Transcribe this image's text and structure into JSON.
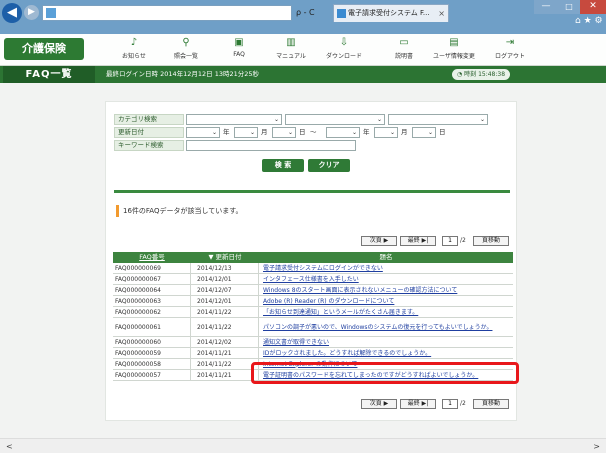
{
  "browser": {
    "address_controls": "ρ - C",
    "tab_title": "電子請求受付システム F...",
    "tab_close": "×",
    "window_controls": [
      "—",
      "□",
      "✕"
    ],
    "tools_icons": "⌂ ★ ⚙"
  },
  "header": {
    "brand": "介護保険",
    "menu": [
      {
        "label": "お知らせ",
        "icon": "bell-icon"
      },
      {
        "label": "照会一覧",
        "icon": "search-icon"
      },
      {
        "label": "FAQ",
        "icon": "faq-icon"
      },
      {
        "label": "マニュアル",
        "icon": "book-icon"
      },
      {
        "label": "ダウンロード",
        "icon": "download-icon"
      },
      {
        "label": "説明書",
        "icon": "monitor-icon"
      },
      {
        "label": "ユーザ情報変更",
        "icon": "user-icon"
      },
      {
        "label": "ログアウト",
        "icon": "logout-icon"
      }
    ]
  },
  "strip": {
    "page_tab": "FAQ一覧",
    "last_login": "最終ログイン日時 2014年12月12日 13時21分25秒",
    "clock_label": "時刻",
    "clock_value": "15:48:38"
  },
  "search": {
    "category_label": "カテゴリ検索",
    "date_label": "更新日付",
    "keyword_label": "キーワード検索",
    "year": "年",
    "month": "月",
    "day": "日",
    "tilde": "～",
    "search_button": "検 索",
    "clear_button": "クリア"
  },
  "results": {
    "count_text": "16件のFAQデータが該当しています。",
    "next": "次頁 ▶",
    "last": "最終 ▶|",
    "page": "1",
    "total": "/2",
    "move": "頁移動"
  },
  "table": {
    "headers": [
      "FAQ番号",
      "更新日付",
      "題名"
    ],
    "rows": [
      {
        "no": "FAQ000000069",
        "date": "2014/12/13",
        "title": "電子請求受付システムにログインができない"
      },
      {
        "no": "FAQ000000067",
        "date": "2014/12/01",
        "title": "インタフェース仕様書を入手したい"
      },
      {
        "no": "FAQ000000064",
        "date": "2014/12/07",
        "title": "Windows 8のスタート画面に表示されないメニューの確認方法について"
      },
      {
        "no": "FAQ000000063",
        "date": "2014/12/01",
        "title": "Adobe (R) Reader (R) のダウンロードについて"
      },
      {
        "no": "FAQ000000062",
        "date": "2014/11/22",
        "title": "「お知らせ到達通知」というメールがたくさん届きます。"
      },
      {
        "no": "FAQ000000061",
        "date": "2014/11/22",
        "title": "パソコンの調子が悪いので、Windowsのシステムの復元を行ってもよいでしょうか。"
      },
      {
        "no": "FAQ000000060",
        "date": "2014/12/02",
        "title": "通知文書が取得できない"
      },
      {
        "no": "FAQ000000059",
        "date": "2014/11/21",
        "title": "IDがロックされました。どうすれば解除できるのでしょうか。"
      },
      {
        "no": "FAQ000000058",
        "date": "2014/11/22",
        "title": "Internet Explorer の動作について"
      },
      {
        "no": "FAQ000000057",
        "date": "2014/11/21",
        "title": "電子証明書のパスワードを忘れてしまったのですがどうすればよいでしょうか。"
      }
    ]
  },
  "scroll": {
    "left": "<",
    "right": ">"
  }
}
